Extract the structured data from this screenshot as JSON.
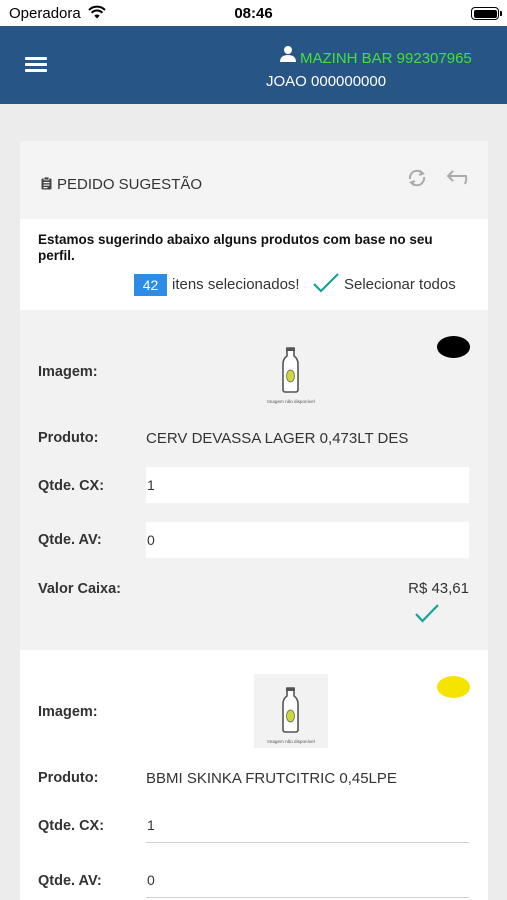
{
  "status_bar": {
    "carrier": "Operadora",
    "time": "08:46"
  },
  "header": {
    "store": "MAZINH BAR 992307965",
    "user": "JOAO 000000000"
  },
  "card": {
    "title": "PEDIDO SUGESTÃO",
    "intro": "Estamos sugerindo abaixo alguns produtos com base no seu perfil.",
    "selected_count": "42",
    "selected_label": "itens selecionados!",
    "select_all": "Selecionar todos"
  },
  "labels": {
    "image": "Imagem:",
    "product": "Produto:",
    "qty_cx": "Qtde. CX:",
    "qty_av": "Qtde. AV:",
    "box_value": "Valor Caixa:"
  },
  "image_placeholder": "Imagem não disponível",
  "products": [
    {
      "name": "CERV DEVASSA LAGER 0,473LT DES",
      "qty_cx": "1",
      "qty_av": "0",
      "box_value": "R$ 43,61",
      "status_color": "#000000"
    },
    {
      "name": "BBMI SKINKA FRUTCITRIC 0,45LPE",
      "qty_cx": "1",
      "qty_av": "0",
      "status_color": "#f5e400"
    }
  ],
  "colors": {
    "header_bg": "#275686",
    "store_text": "#44e03a",
    "badge_bg": "#2c8ce6",
    "check": "#17a398"
  },
  "icons": [
    "wifi-icon",
    "battery-icon",
    "menu-icon",
    "user-icon",
    "clipboard-icon",
    "refresh-icon",
    "undo-icon",
    "check-icon",
    "bottle-icon"
  ]
}
